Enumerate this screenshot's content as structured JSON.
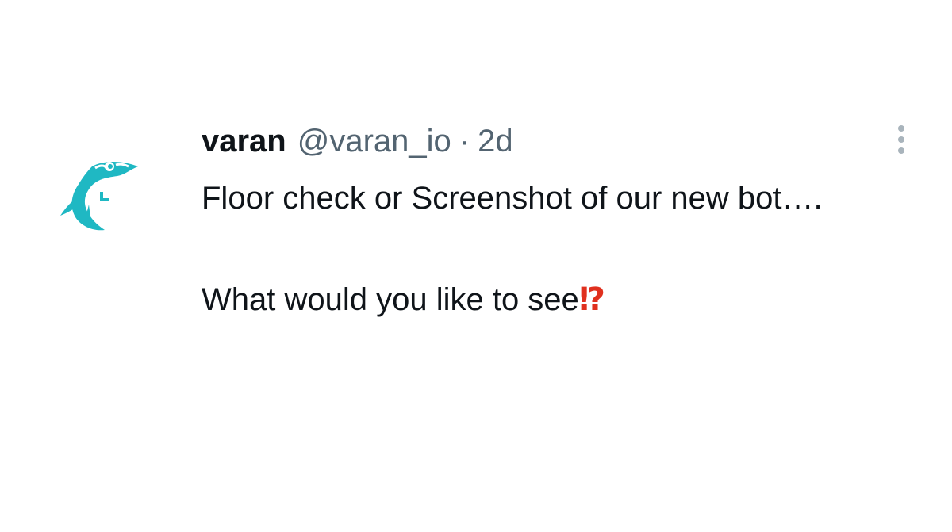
{
  "tweet": {
    "author": {
      "display_name": "varan",
      "handle": "@varan_io",
      "separator": "·",
      "time_ago": "2d",
      "avatar_icon": "varan-lizard-logo-icon",
      "avatar_color": "#1fb8c3"
    },
    "text": {
      "line1": "Floor check or Screenshot of our new bot….",
      "line2": "What would you like to see",
      "line2_emoji": "⁉"
    },
    "more_icon": "more-vertical-icon"
  },
  "colors": {
    "text_primary": "#0f1419",
    "text_secondary": "#536471",
    "emoji_red": "#e0301e",
    "more_dots": "#a9b4bc"
  }
}
